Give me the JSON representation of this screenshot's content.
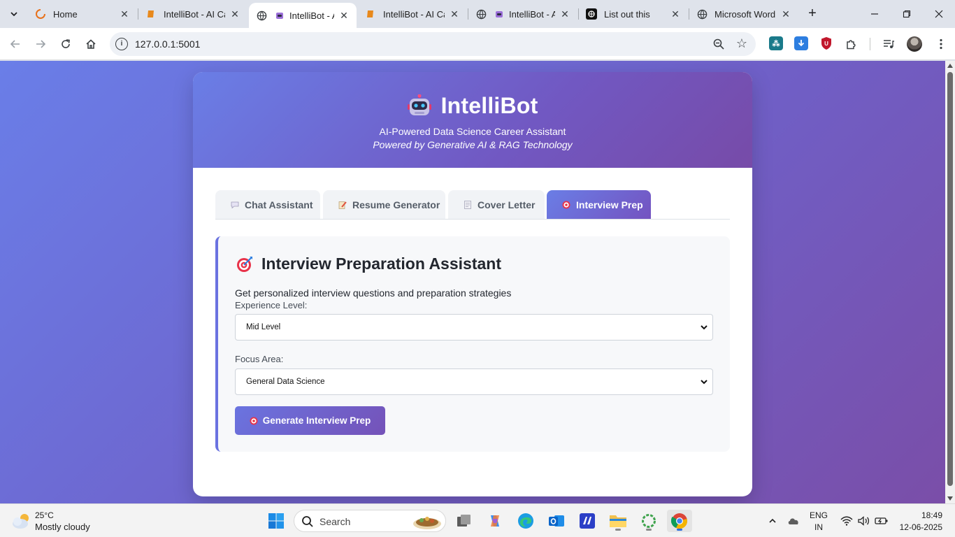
{
  "browser": {
    "tabs": [
      {
        "title": "Home",
        "icon": "loading-spinner-icon"
      },
      {
        "title": "IntelliBot - AI Ca",
        "icon": "book-icon"
      },
      {
        "title": "IntelliBot - A",
        "icon": "globe-icon",
        "active": true
      },
      {
        "title": "IntelliBot - AI Ca",
        "icon": "book-icon"
      },
      {
        "title": "IntelliBot - A",
        "icon": "globe-icon"
      },
      {
        "title": "List out this",
        "icon": "openai-icon"
      },
      {
        "title": "Microsoft Word",
        "icon": "globe-icon"
      }
    ],
    "url": "127.0.0.1:5001"
  },
  "app": {
    "title": "IntelliBot",
    "subtitle": "AI-Powered Data Science Career Assistant",
    "tagline": "Powered by Generative AI & RAG Technology",
    "tabs": [
      {
        "label": "Chat Assistant",
        "icon": "speech-bubble-icon"
      },
      {
        "label": "Resume Generator",
        "icon": "memo-icon"
      },
      {
        "label": "Cover Letter",
        "icon": "page-icon"
      },
      {
        "label": "Interview Prep",
        "icon": "target-icon",
        "active": true
      }
    ]
  },
  "interview": {
    "heading": "Interview Preparation Assistant",
    "description": "Get personalized interview questions and preparation strategies",
    "experience_label": "Experience Level:",
    "experience_value": "Mid Level",
    "focus_label": "Focus Area:",
    "focus_value": "General Data Science",
    "button_label": "Generate Interview Prep"
  },
  "taskbar": {
    "weather_temp": "25°C",
    "weather_cond": "Mostly cloudy",
    "search_label": "Search",
    "lang_top": "ENG",
    "lang_bottom": "IN",
    "time": "18:49",
    "date": "12-06-2025"
  },
  "colors": {
    "accent_start": "#6a7ee6",
    "accent_end": "#7453c0",
    "panel_border": "#6a72e0"
  }
}
